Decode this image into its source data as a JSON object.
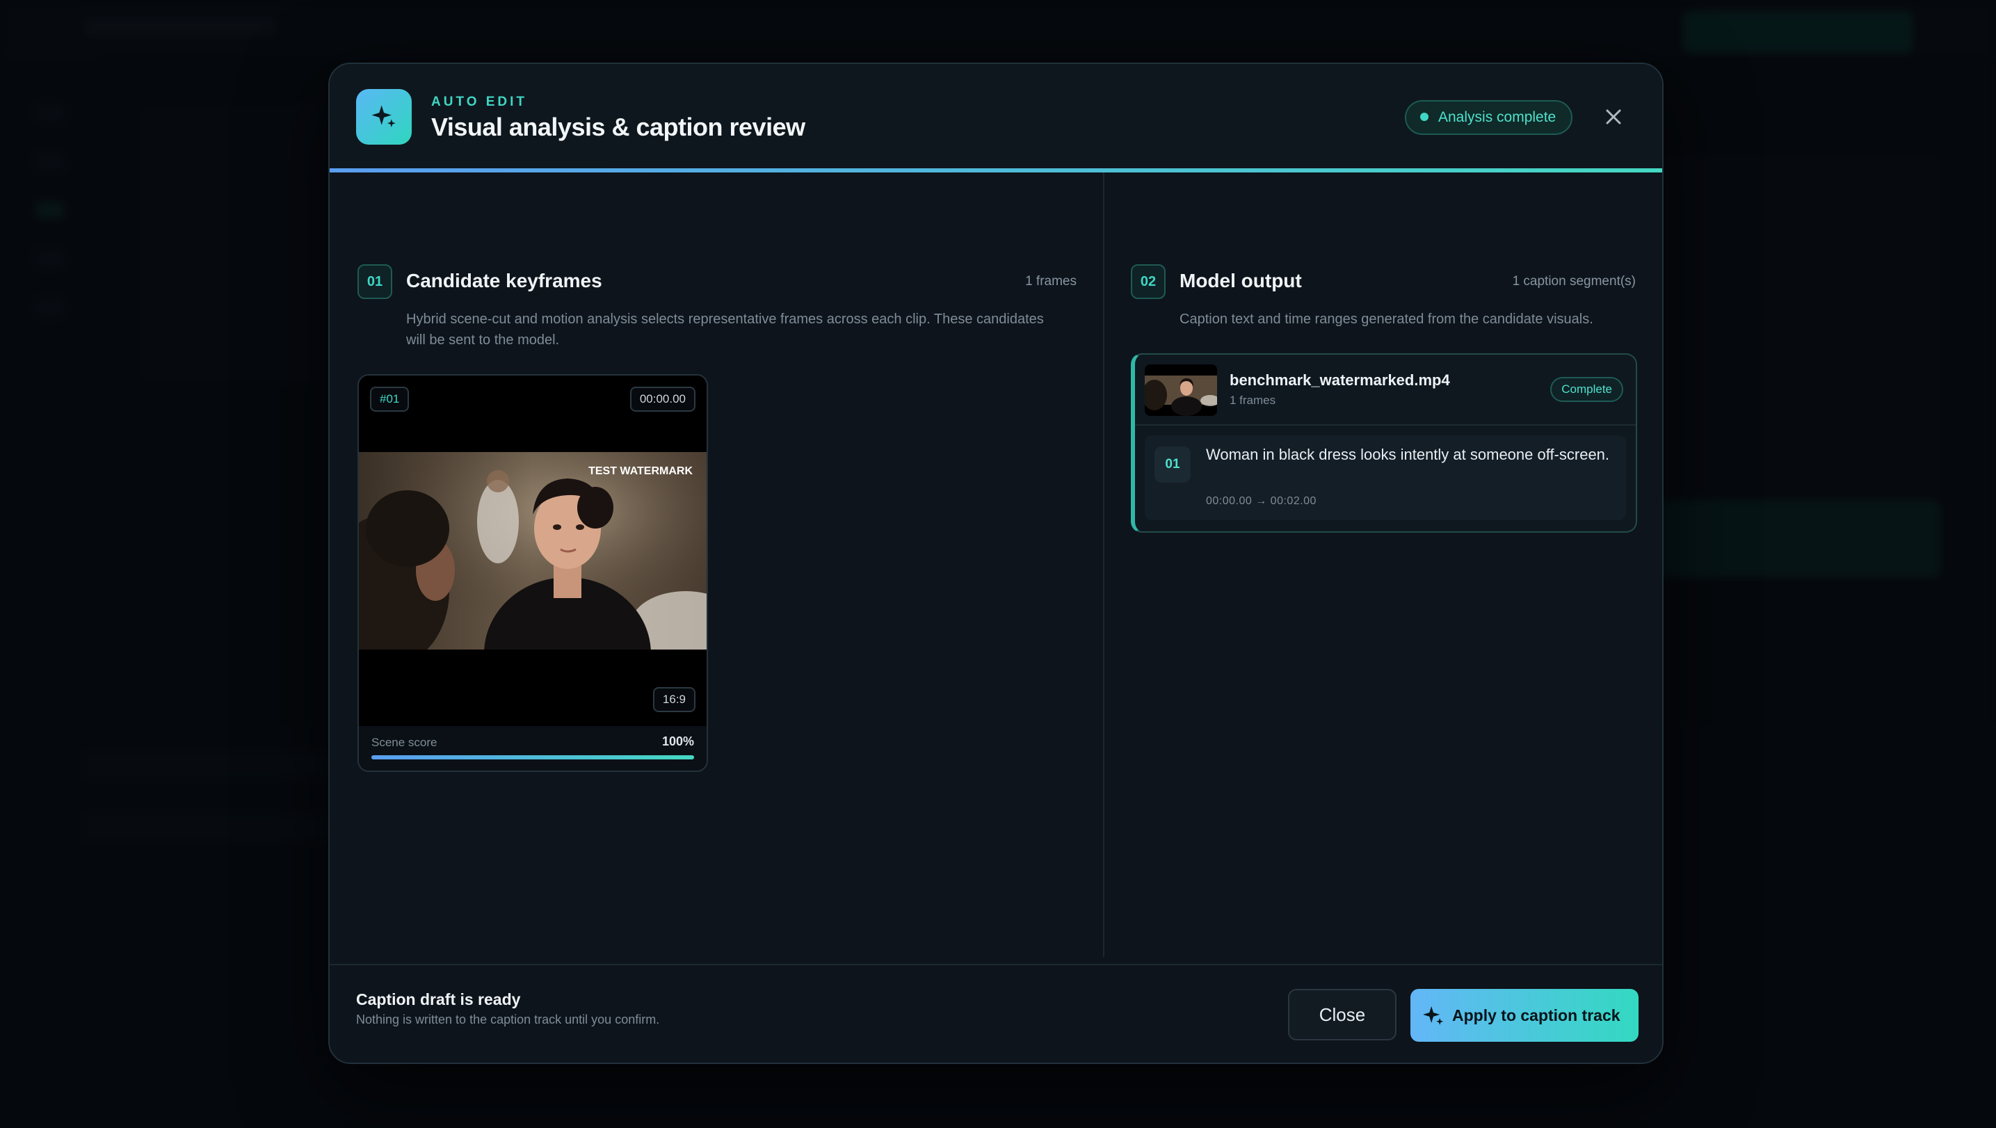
{
  "header": {
    "eyebrow": "AUTO EDIT",
    "title": "Visual analysis & caption review",
    "status": "Analysis complete",
    "icon": "sparkle-icon",
    "close_icon": "close-icon"
  },
  "keyframes": {
    "step": "01",
    "title": "Candidate keyframes",
    "count": "1 frames",
    "description": "Hybrid scene-cut and motion analysis selects representative frames across each clip. These candidates will be sent to the model.",
    "items": [
      {
        "index": "#01",
        "timestamp": "00:00.00",
        "aspect": "16:9",
        "watermark": "TEST WATERMARK",
        "score_label": "Scene score",
        "score_value": "100%",
        "score": 1.0
      }
    ]
  },
  "model_output": {
    "step": "02",
    "title": "Model output",
    "count": "1 caption segment(s)",
    "description": "Caption text and time ranges generated from the candidate visuals.",
    "file": {
      "name": "benchmark_watermarked.mp4",
      "frames": "1 frames",
      "status": "Complete"
    },
    "segments": [
      {
        "index": "01",
        "text": "Woman in black dress looks intently at someone off-screen.",
        "range": "00:00.00 → 00:02.00"
      }
    ]
  },
  "footer": {
    "title": "Caption draft is ready",
    "subtitle": "Nothing is written to the caption track until you confirm.",
    "close_label": "Close",
    "apply_label": "Apply to caption track"
  },
  "colors": {
    "accent_teal": "#3fd7c4",
    "accent_blue": "#5a9df0",
    "background": "#0d141b"
  }
}
